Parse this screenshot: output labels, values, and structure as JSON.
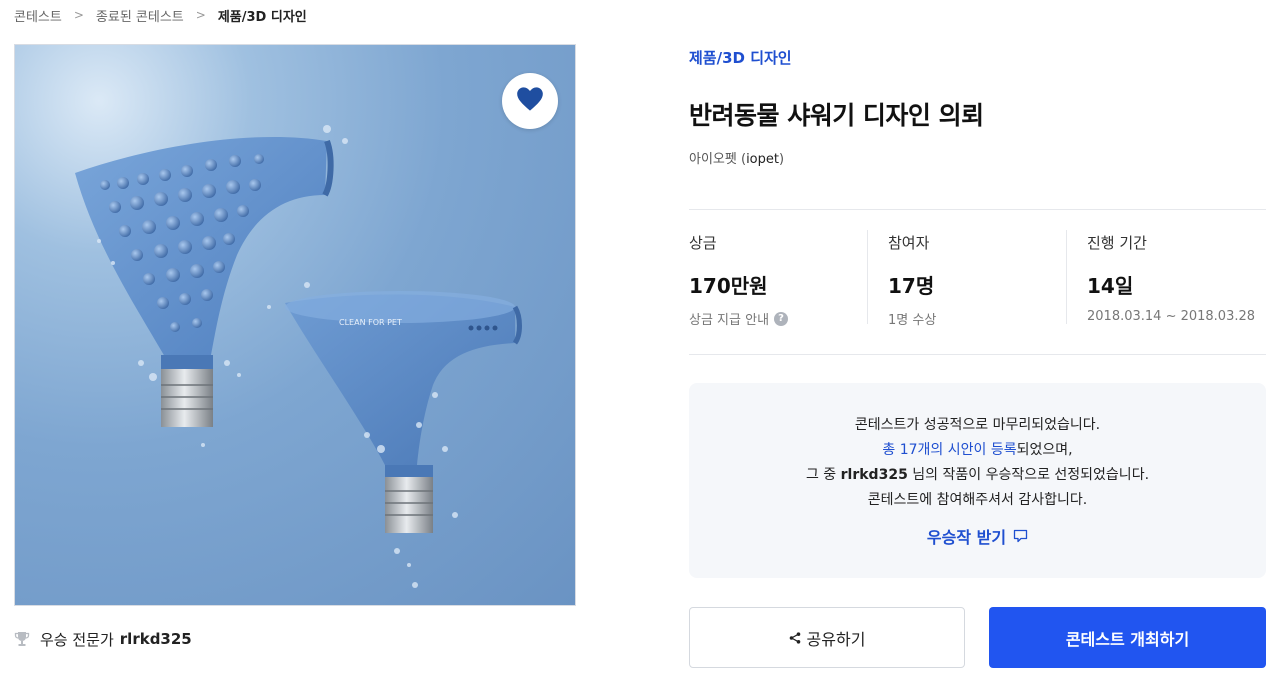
{
  "breadcrumb": {
    "items": [
      "콘테스트",
      "종료된 콘테스트",
      "제품/3D 디자인"
    ]
  },
  "hero": {
    "product_print": "CLEAN FOR PET"
  },
  "winner": {
    "label": "우승 전문가",
    "name": "rlrkd325"
  },
  "contest": {
    "category": "제품/3D 디자인",
    "title": "반려동물 샤워기 디자인 의뢰",
    "host_name": "아이오펫",
    "host_id": "iopet"
  },
  "stats": [
    {
      "label": "상금",
      "value": "170만원",
      "sub": "상금 지급 안내"
    },
    {
      "label": "참여자",
      "value": "17명",
      "sub": "1명 수상"
    },
    {
      "label": "진행 기간",
      "value": "14일",
      "sub": "2018.03.14 ~ 2018.03.28"
    }
  ],
  "notice": {
    "line1": "콘테스트가 성공적으로 마무리되었습니다.",
    "line2_blue": "총 17개의 시안이 등록",
    "line2_rest": "되었으며,",
    "line3_pre": "그 중 ",
    "line3_name": "rlrkd325",
    "line3_post": " 님의 작품이 우승작으로 선정되었습니다.",
    "line4": "콘테스트에 참여해주셔서 감사합니다.",
    "link_label": "우승작 받기"
  },
  "buttons": {
    "share": "공유하기",
    "host": "콘테스트 개최하기"
  },
  "icons": [
    "chevron-right-icon",
    "heart-icon",
    "trophy-icon",
    "help-icon",
    "comment-icon",
    "share-icon"
  ],
  "colors": {
    "accent_blue": "#1f4fd0",
    "cta_blue": "#2155f0",
    "panel_bg": "#f5f7fa",
    "image_blue": "#7ea6d1"
  }
}
